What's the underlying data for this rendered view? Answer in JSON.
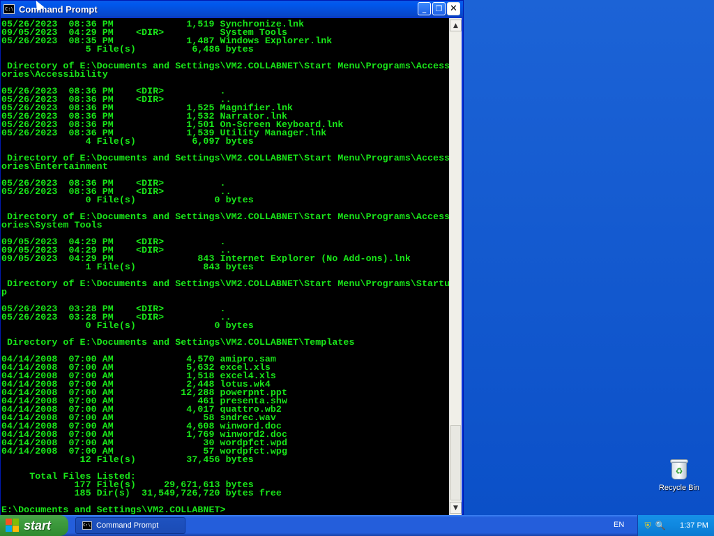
{
  "window": {
    "title": "Command Prompt",
    "minimize_label": "_",
    "maximize_label": "❐",
    "close_label": "✕"
  },
  "console_lines": [
    "05/26/2023  08:36 PM             1,519 Synchronize.lnk",
    "09/05/2023  04:29 PM    <DIR>          System Tools",
    "05/26/2023  08:35 PM             1,487 Windows Explorer.lnk",
    "               5 File(s)          6,486 bytes",
    "",
    " Directory of E:\\Documents and Settings\\VM2.COLLABNET\\Start Menu\\Programs\\Access",
    "ories\\Accessibility",
    "",
    "05/26/2023  08:36 PM    <DIR>          .",
    "05/26/2023  08:36 PM    <DIR>          ..",
    "05/26/2023  08:36 PM             1,525 Magnifier.lnk",
    "05/26/2023  08:36 PM             1,532 Narrator.lnk",
    "05/26/2023  08:36 PM             1,501 On-Screen Keyboard.lnk",
    "05/26/2023  08:36 PM             1,539 Utility Manager.lnk",
    "               4 File(s)          6,097 bytes",
    "",
    " Directory of E:\\Documents and Settings\\VM2.COLLABNET\\Start Menu\\Programs\\Access",
    "ories\\Entertainment",
    "",
    "05/26/2023  08:36 PM    <DIR>          .",
    "05/26/2023  08:36 PM    <DIR>          ..",
    "               0 File(s)              0 bytes",
    "",
    " Directory of E:\\Documents and Settings\\VM2.COLLABNET\\Start Menu\\Programs\\Access",
    "ories\\System Tools",
    "",
    "09/05/2023  04:29 PM    <DIR>          .",
    "09/05/2023  04:29 PM    <DIR>          ..",
    "09/05/2023  04:29 PM               843 Internet Explorer (No Add-ons).lnk",
    "               1 File(s)            843 bytes",
    "",
    " Directory of E:\\Documents and Settings\\VM2.COLLABNET\\Start Menu\\Programs\\Startu",
    "p",
    "",
    "05/26/2023  03:28 PM    <DIR>          .",
    "05/26/2023  03:28 PM    <DIR>          ..",
    "               0 File(s)              0 bytes",
    "",
    " Directory of E:\\Documents and Settings\\VM2.COLLABNET\\Templates",
    "",
    "04/14/2008  07:00 AM             4,570 amipro.sam",
    "04/14/2008  07:00 AM             5,632 excel.xls",
    "04/14/2008  07:00 AM             1,518 excel4.xls",
    "04/14/2008  07:00 AM             2,448 lotus.wk4",
    "04/14/2008  07:00 AM            12,288 powerpnt.ppt",
    "04/14/2008  07:00 AM               461 presenta.shw",
    "04/14/2008  07:00 AM             4,017 quattro.wb2",
    "04/14/2008  07:00 AM                58 sndrec.wav",
    "04/14/2008  07:00 AM             4,608 winword.doc",
    "04/14/2008  07:00 AM             1,769 winword2.doc",
    "04/14/2008  07:00 AM                30 wordpfct.wpd",
    "04/14/2008  07:00 AM                57 wordpfct.wpg",
    "              12 File(s)         37,456 bytes",
    "",
    "     Total Files Listed:",
    "             177 File(s)     29,671,613 bytes",
    "             185 Dir(s)  31,549,726,720 bytes free",
    "",
    "E:\\Documents and Settings\\VM2.COLLABNET>"
  ],
  "scrollbar": {
    "up_arrow": "▲",
    "down_arrow": "▼"
  },
  "desktop": {
    "recycle_bin_label": "Recycle Bin",
    "recycle_symbol": "♻"
  },
  "taskbar": {
    "start_label": "start",
    "task_button_label": "Command Prompt",
    "language": "EN",
    "clock": "1:37 PM",
    "tray_shield": "⛨",
    "tray_search": "🔍"
  }
}
